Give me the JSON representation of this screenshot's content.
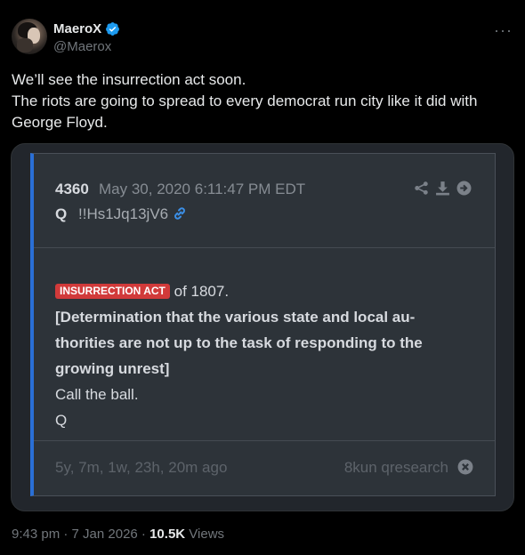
{
  "author": {
    "display_name": "MaeroX",
    "handle": "@Maerox",
    "verified": true,
    "avatar": "avatar-photo"
  },
  "more_icon": "more-icon",
  "tweet": {
    "lines": [
      "We’ll see the insurrection act soon.",
      "The riots are going to spread to every democrat run city like it did with",
      "George Floyd."
    ]
  },
  "qpost": {
    "number": "4360",
    "date": "May 30, 2020 6:11:47 PM EDT",
    "author": "Q",
    "tripcode": "!!Hs1Jq13jV6",
    "icons": [
      "share-icon",
      "download-icon",
      "forward-icon",
      "link-icon"
    ],
    "badge": "INSURRECTION ACT",
    "after_badge": " of 1807.",
    "bold_lines": [
      "[Determination that the various state and local au-",
      "thorities are not up to the task of responding to the",
      "growing unrest]"
    ],
    "line1": "Call the ball.",
    "signature": "Q",
    "ago": "5y, 7m, 1w, 23h, 20m ago",
    "source": "8kun qresearch",
    "accent_color": "#2a6fd6",
    "badge_color": "#d13a3a"
  },
  "meta": {
    "time": "9:43 pm · 7 Jan 2026 · ",
    "views_count": "10.5K",
    "views_label": " Views"
  }
}
